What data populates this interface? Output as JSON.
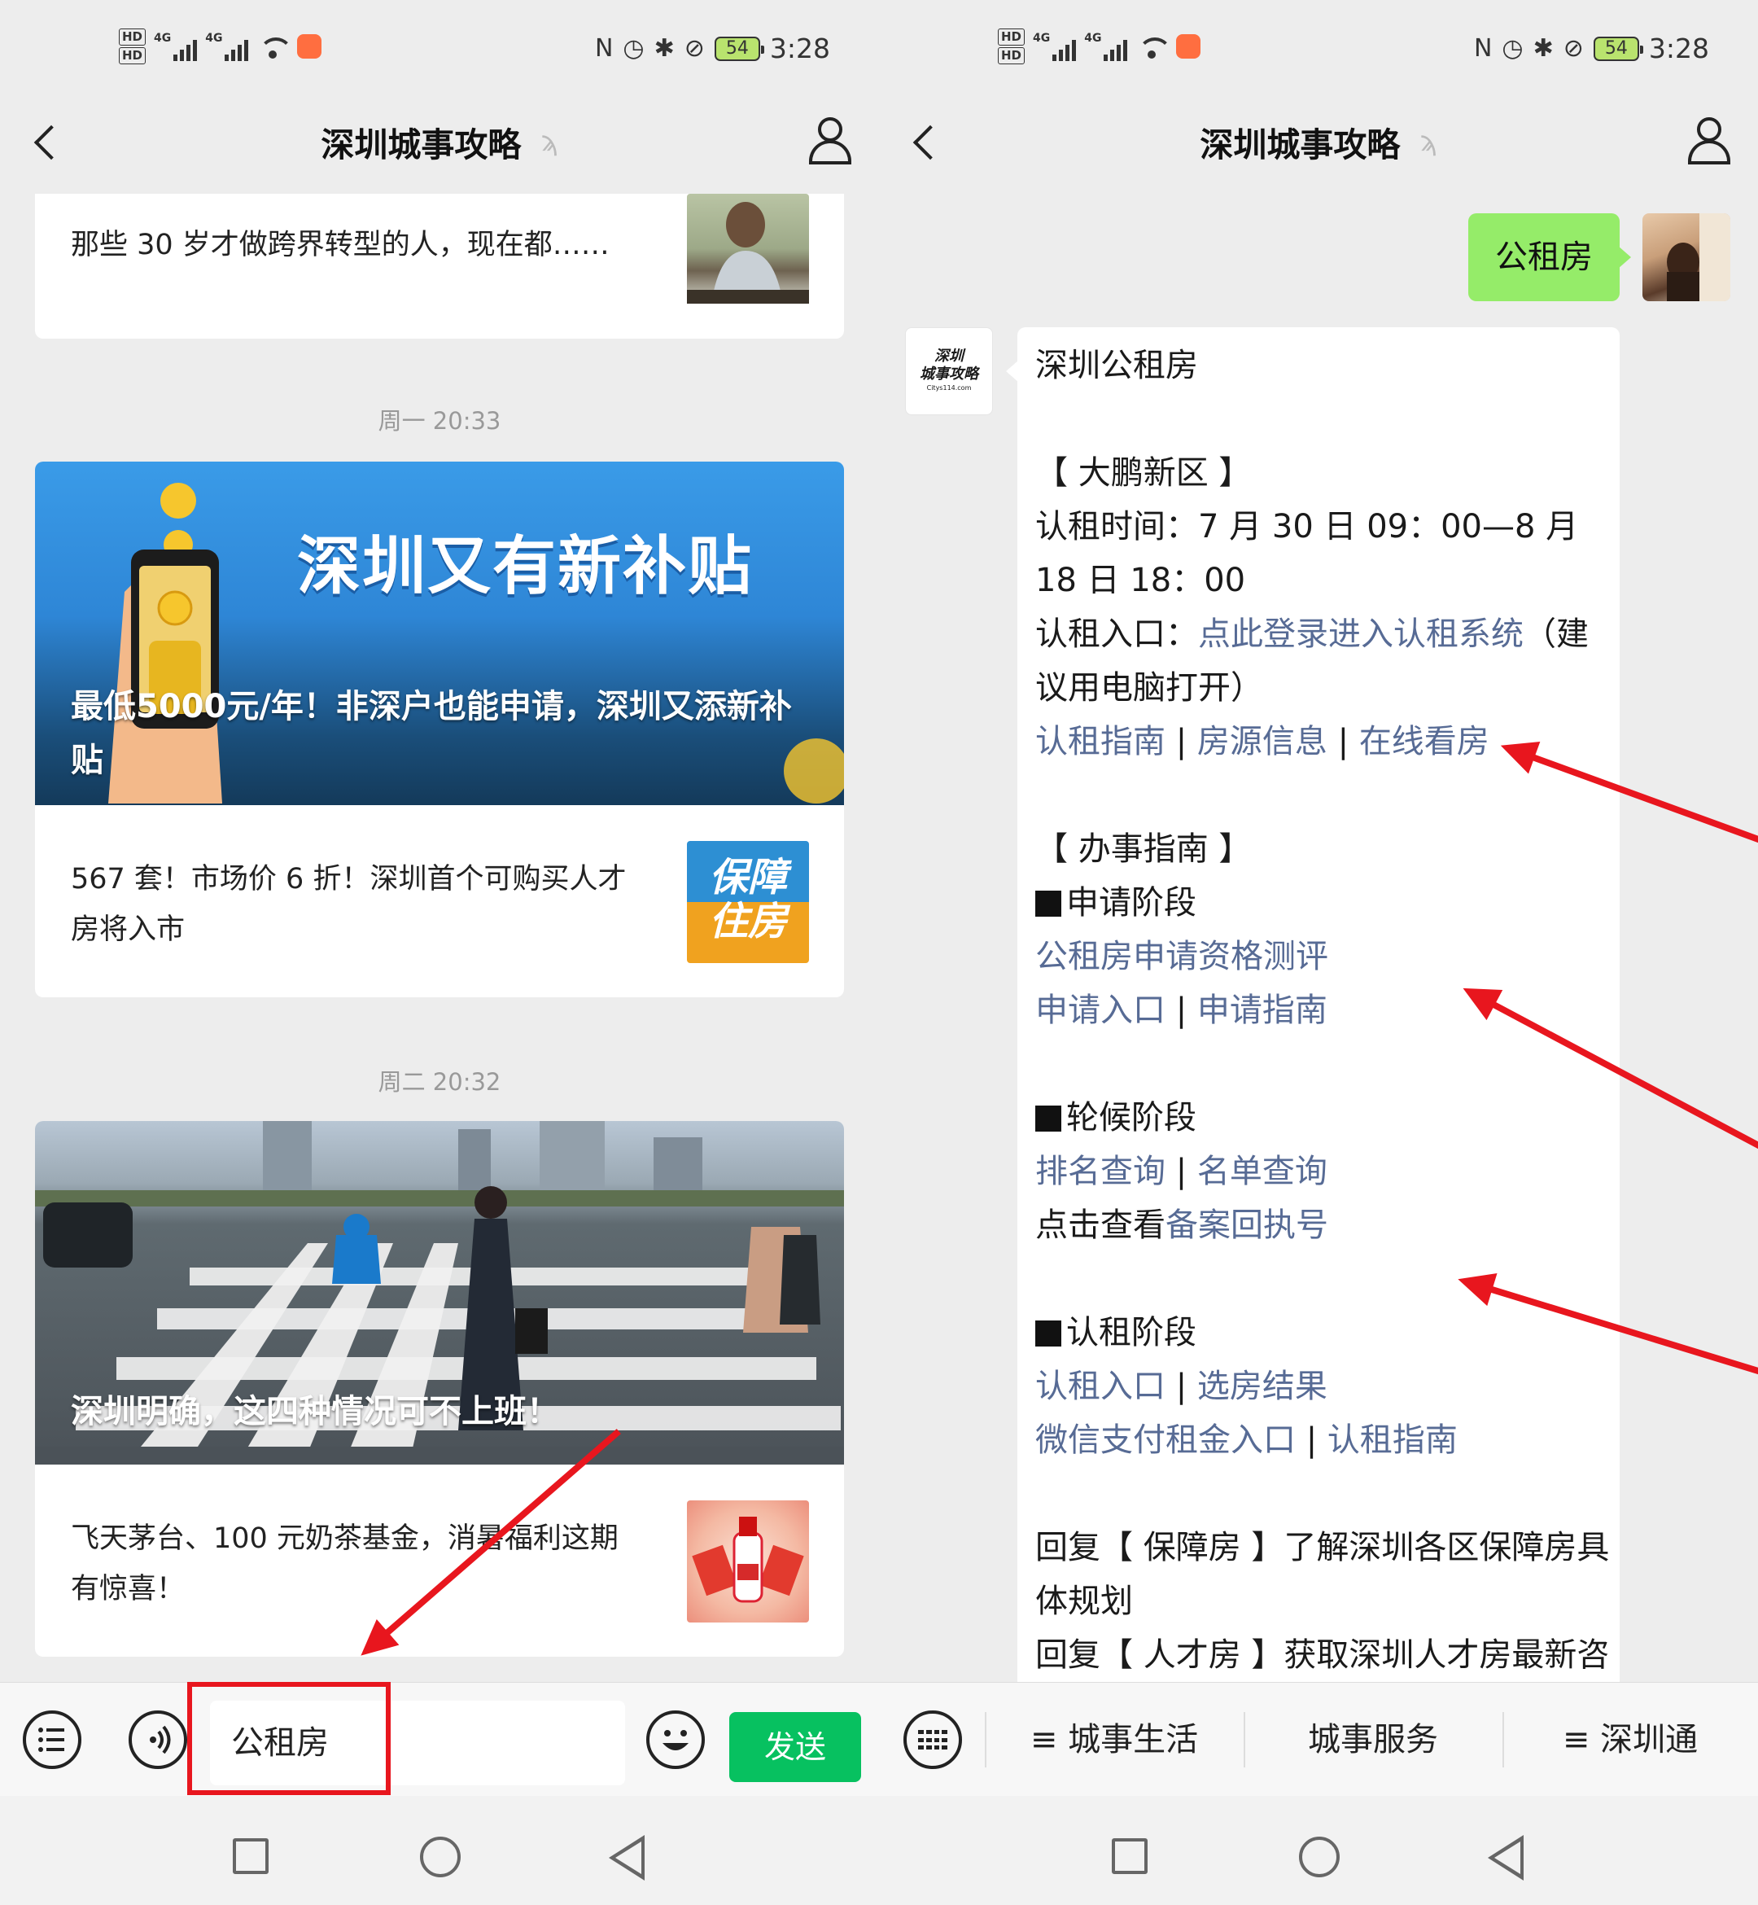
{
  "status_bar": {
    "time": "3:28",
    "battery": "54",
    "hd1": "HD",
    "hd2": "HD",
    "net1": "4G",
    "net2": "4G"
  },
  "header": {
    "title": "深圳城事攻略"
  },
  "left": {
    "card1_text": "那些 30 岁才做跨界转型的人，现在都……",
    "timestamp1": "周一 20:33",
    "hero1_big_title": "深圳又有新补贴",
    "hero1_caption_line1": "最低5000元/年！非深户也能申请，深圳又添新补",
    "hero1_caption_line2": "贴",
    "card2_item_line1": "567 套！市场价 6 折！深圳首个可购买人才",
    "card2_item_line2": "房将入市",
    "card2_thumb_line1": "保障",
    "card2_thumb_line2": "住房",
    "timestamp2": "周二 20:32",
    "hero2_caption": "深圳明确，这四种情况可不上班！",
    "card3_item_line1": "飞天茅台、100 元奶茶基金，消暑福利这期",
    "card3_item_line2": "有惊喜！",
    "input_value": "公租房",
    "send_label": "发送"
  },
  "right": {
    "my_message": "公租房",
    "bot_avatar_line1": "深圳",
    "bot_avatar_line2": "城事攻略",
    "bot_avatar_line3": "Citys114.com",
    "reply": {
      "l01": "深圳公租房",
      "l02": "【 大鹏新区 】",
      "l03": "认租时间：7 月 30 日 09：00—8 月",
      "l04": "18 日 18：00",
      "l05a": "认租入口：",
      "l05b": "点此登录进入认租系统",
      "l05c": "（建",
      "l06": "议用电脑打开）",
      "l07a": "认租指南",
      "l07b": "房源信息",
      "l07c": "在线看房",
      "l08": "【 办事指南 】",
      "l09": "申请阶段",
      "l10": "公租房申请资格测评",
      "l11a": "申请入口",
      "l11b": "申请指南",
      "l12": "轮候阶段",
      "l13a": "排名查询",
      "l13b": "名单查询",
      "l14a": "点击查看",
      "l14b": "备案回执号",
      "l15": "认租阶段",
      "l16a": "认租入口",
      "l16b": "选房结果",
      "l17a": "微信支付租金入口",
      "l17b": "认租指南",
      "l18": "回复【 保障房 】了解深圳各区保障房具",
      "l19": "体规划",
      "l20": "回复【 人才房 】获取深圳人才房最新咨"
    },
    "menu": [
      "≡ 城事生活",
      "城事服务",
      "≡ 深圳通"
    ]
  },
  "colors": {
    "link": "#576b95",
    "send_green": "#07c160",
    "my_bubble": "#95ec69",
    "annotation_red": "#e8161e"
  }
}
